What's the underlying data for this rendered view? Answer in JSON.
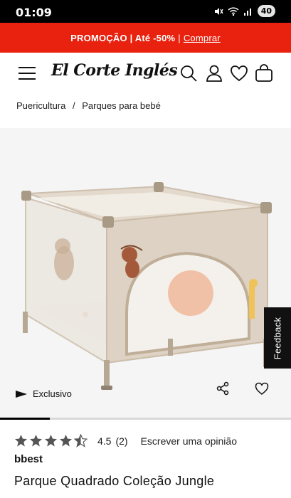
{
  "status_bar": {
    "time": "01:09",
    "battery": "40"
  },
  "promo": {
    "text": "PROMOÇÃO | Até -50%",
    "separator": "|",
    "link": "Comprar"
  },
  "header": {
    "logo": "El Corte Inglés"
  },
  "breadcrumb": {
    "items": [
      "Puericultura",
      "Parques para bebé"
    ],
    "separator": "/"
  },
  "gallery": {
    "badge": "Exclusivo",
    "progress_fraction": 0.17
  },
  "feedback": {
    "label": "Feedback"
  },
  "product": {
    "rating_value": "4.5",
    "rating_count": "(2)",
    "rating_stars": 4.5,
    "write_review": "Escrever uma opinião",
    "brand": "bbest",
    "title": "Parque Quadrado Coleção Jungle"
  },
  "colors": {
    "promo_bg": "#e8220f",
    "text": "#1a1a1a",
    "star": "#555555"
  }
}
